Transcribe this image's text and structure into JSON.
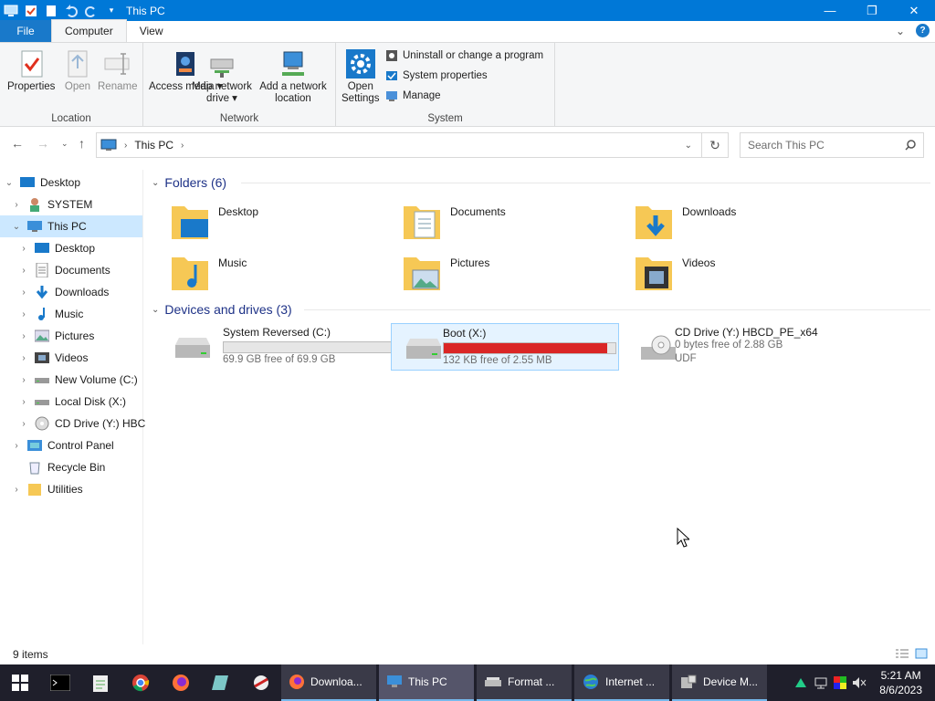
{
  "window": {
    "title": "This PC"
  },
  "ribbon_tabs": [
    "File",
    "Computer",
    "View"
  ],
  "ribbon": {
    "location": {
      "label": "Location",
      "properties": "Properties",
      "open": "Open",
      "rename": "Rename"
    },
    "network": {
      "label": "Network",
      "access_media": "Access media",
      "map_drive_line1": "Map network",
      "map_drive_line2": "drive",
      "add_location_line1": "Add a network",
      "add_location_line2": "location"
    },
    "system": {
      "label": "System",
      "open_settings_line1": "Open",
      "open_settings_line2": "Settings",
      "uninstall": "Uninstall or change a program",
      "system_properties": "System properties",
      "manage": "Manage"
    }
  },
  "address": {
    "crumb": "This PC",
    "search_placeholder": "Search This PC"
  },
  "nav_pane": {
    "items": [
      {
        "label": "Desktop",
        "icon": "desktop-icon"
      },
      {
        "label": "SYSTEM",
        "icon": "user-icon"
      },
      {
        "label": "This PC",
        "icon": "computer-icon"
      },
      {
        "label": "Desktop",
        "icon": "desktop-icon"
      },
      {
        "label": "Documents",
        "icon": "documents-icon"
      },
      {
        "label": "Downloads",
        "icon": "download-icon"
      },
      {
        "label": "Music",
        "icon": "music-icon"
      },
      {
        "label": "Pictures",
        "icon": "pictures-icon"
      },
      {
        "label": "Videos",
        "icon": "videos-icon"
      },
      {
        "label": "New Volume (C:)",
        "icon": "drive-icon"
      },
      {
        "label": "Local Disk (X:)",
        "icon": "drive-icon"
      },
      {
        "label": "CD Drive (Y:) HBC",
        "icon": "cd-icon"
      },
      {
        "label": "Control Panel",
        "icon": "control-panel-icon"
      },
      {
        "label": "Recycle Bin",
        "icon": "recycle-bin-icon"
      },
      {
        "label": "Utilities",
        "icon": "folder-icon"
      }
    ]
  },
  "folders": {
    "header": "Folders (6)",
    "items": [
      "Desktop",
      "Documents",
      "Downloads",
      "Music",
      "Pictures",
      "Videos"
    ]
  },
  "drives": {
    "header": "Devices and drives (3)",
    "items": [
      {
        "name": "System Reversed (C:)",
        "free": "69.9 GB free of 69.9 GB",
        "used_fraction": 0.0
      },
      {
        "name": "Boot (X:)",
        "free": "132 KB free of 2.55 MB",
        "used_fraction": 0.95
      },
      {
        "name": "CD Drive (Y:) HBCD_PE_x64",
        "free": "0 bytes free of 2.88 GB",
        "fs": "UDF"
      }
    ]
  },
  "status": {
    "items": "9 items"
  },
  "taskbar": {
    "windows": [
      "Downloa...",
      "This PC",
      "Format ...",
      "Internet ...",
      "Device M..."
    ],
    "time": "5:21 AM",
    "date": "8/6/2023"
  },
  "colors": {
    "accent": "#0078d7",
    "drive_full": "#da2626",
    "folder": "#f6c855"
  }
}
